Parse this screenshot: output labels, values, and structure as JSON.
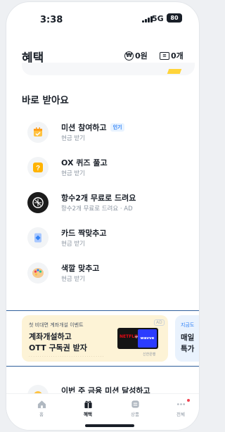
{
  "status_bar": {
    "time": "3:38",
    "network": "5G",
    "battery": "80"
  },
  "header": {
    "title": "혜택",
    "points": "0원",
    "tickets": "0개"
  },
  "section_title": "바로 받아요",
  "items": [
    {
      "title": "미션 참여하고",
      "badge": "인기",
      "subtitle": "현금 받기",
      "icon": "calendar-icon"
    },
    {
      "title": "OX 퀴즈 풀고",
      "subtitle": "현금 받기",
      "icon": "quiz-icon"
    },
    {
      "title": "항수2개 무료로 드려요",
      "subtitle": "항수2개 무료로 드려요 · AD",
      "icon": "brand-logo-icon"
    },
    {
      "title": "카드 짝맞추고",
      "subtitle": "현금 받기",
      "icon": "card-match-icon"
    },
    {
      "title": "색깔 맞추고",
      "subtitle": "현금 받기",
      "icon": "palette-icon"
    }
  ],
  "banner": {
    "card1": {
      "eyebrow": "첫 비대면 계좌개설 이벤트",
      "line1": "계좌개설하고",
      "line2": "OTT 구독권 받자",
      "ad_tag": "AD",
      "netflix": "NETFLIX",
      "wavve": "wavve",
      "bank": "신한은행"
    },
    "card2": {
      "eyebrow": "지금도",
      "line1": "매일",
      "line2": "특가"
    }
  },
  "partial_item": {
    "title": "이번 주 금융 미션 달성하고"
  },
  "tabs": [
    {
      "label": "홈",
      "icon": "home-icon"
    },
    {
      "label": "혜택",
      "icon": "gift-icon",
      "active": true
    },
    {
      "label": "상품",
      "icon": "product-icon"
    },
    {
      "label": "전체",
      "icon": "more-icon"
    }
  ],
  "colors": {
    "accent": "#3182f6",
    "banner_card": "#fdf3d6",
    "badge_bg": "#e8f3ff"
  }
}
